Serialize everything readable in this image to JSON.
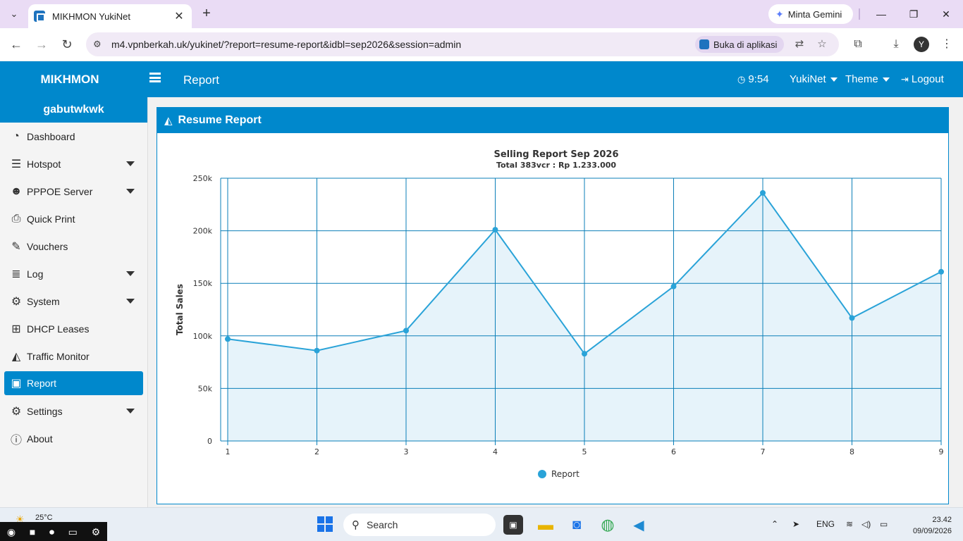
{
  "browser": {
    "tab_title": "MIKHMON YukiNet",
    "new_tab": "+",
    "gemini": "Minta Gemini",
    "url": "m4.vpnberkah.uk/yukinet/?report=resume-report&idbl=sep2026&session=admin",
    "open_in_app": "Buka di aplikasi",
    "profile_initial": "Y"
  },
  "header": {
    "brand": "MIKHMON",
    "page_title": "Report",
    "time": "9:54",
    "session": "YukiNet",
    "theme": "Theme",
    "logout": "Logout"
  },
  "sidebar": {
    "user": "gabutwkwk",
    "items": [
      {
        "label": "Dashboard",
        "icon": "dashboard-icon",
        "glyph": "◔",
        "has_submenu": false
      },
      {
        "label": "Hotspot",
        "icon": "wifi-icon",
        "glyph": "☰",
        "has_submenu": true
      },
      {
        "label": "PPPOE Server",
        "icon": "users-icon",
        "glyph": "☻",
        "has_submenu": true
      },
      {
        "label": "Quick Print",
        "icon": "print-icon",
        "glyph": "⎙",
        "has_submenu": false
      },
      {
        "label": "Vouchers",
        "icon": "ticket-icon",
        "glyph": "✎",
        "has_submenu": false
      },
      {
        "label": "Log",
        "icon": "list-icon",
        "glyph": "≣",
        "has_submenu": true
      },
      {
        "label": "System",
        "icon": "gear-icon",
        "glyph": "⚙",
        "has_submenu": true
      },
      {
        "label": "DHCP Leases",
        "icon": "sitemap-icon",
        "glyph": "⊞",
        "has_submenu": false
      },
      {
        "label": "Traffic Monitor",
        "icon": "area-chart-icon",
        "glyph": "◭",
        "has_submenu": false
      },
      {
        "label": "Report",
        "icon": "money-icon",
        "glyph": "▣",
        "has_submenu": false,
        "active": true
      },
      {
        "label": "Settings",
        "icon": "gear-icon",
        "glyph": "⚙",
        "has_submenu": true
      },
      {
        "label": "About",
        "icon": "info-icon",
        "glyph": "ⓘ",
        "has_submenu": false
      }
    ]
  },
  "card": {
    "title": "Resume Report"
  },
  "chart_data": {
    "type": "area",
    "title": "Selling Report Sep 2026",
    "subtitle": "Total 383vcr : Rp 1.233.000",
    "xlabel": "",
    "ylabel": "Total Sales",
    "x": [
      1,
      2,
      3,
      4,
      5,
      6,
      7,
      8,
      9
    ],
    "series": [
      {
        "name": "Report",
        "values": [
          97000,
          86000,
          105000,
          201000,
          83000,
          147000,
          236000,
          117000,
          161000
        ]
      }
    ],
    "ylim": [
      0,
      250000
    ],
    "yticks": [
      0,
      50000,
      100000,
      150000,
      200000,
      250000
    ],
    "ytick_labels": [
      "0",
      "50k",
      "100k",
      "150k",
      "200k",
      "250k"
    ],
    "grid": true,
    "legend": "bottom-center",
    "color": "#2aa3d8",
    "fill_color": "#e6f3fa",
    "grid_color": "#0b7fb8"
  },
  "taskbar": {
    "temperature": "25°C",
    "search_label": "Search",
    "language": "ENG",
    "time": "23.42",
    "date": "09/09/2026"
  },
  "colors": {
    "primary": "#0088cc",
    "browser_frame": "#eadcf5"
  }
}
